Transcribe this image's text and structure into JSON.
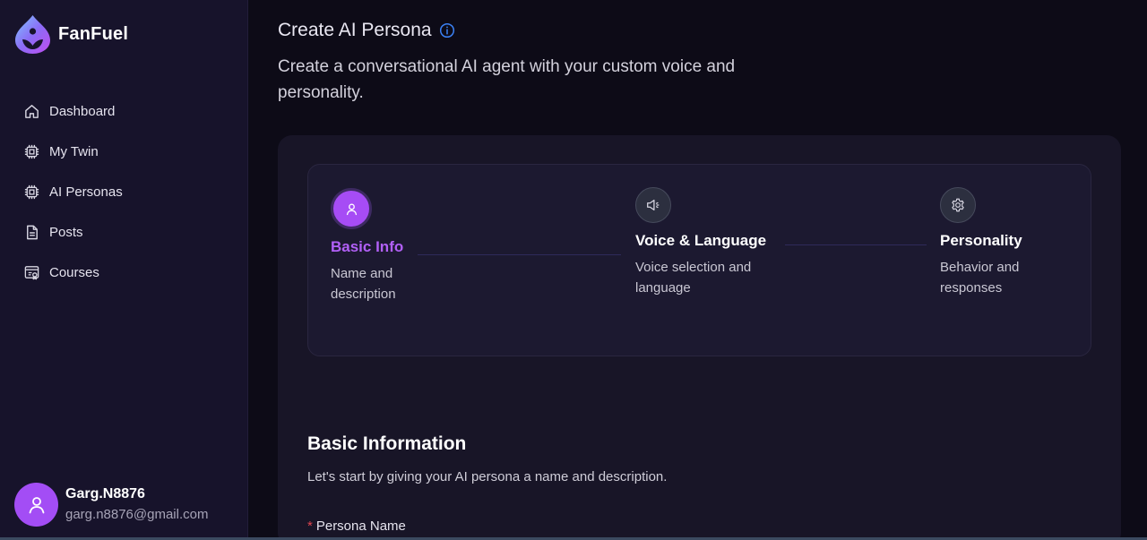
{
  "brand": {
    "name": "FanFuel"
  },
  "sidebar": {
    "items": [
      {
        "label": "Dashboard",
        "icon": "home-icon"
      },
      {
        "label": "My Twin",
        "icon": "chip-icon"
      },
      {
        "label": "AI Personas",
        "icon": "chip-icon"
      },
      {
        "label": "Posts",
        "icon": "document-icon"
      },
      {
        "label": "Courses",
        "icon": "courses-icon"
      }
    ]
  },
  "user": {
    "name": "Garg.N8876",
    "email": "garg.n8876@gmail.com"
  },
  "header": {
    "title": "Create AI Persona",
    "subtitle": "Create a conversational AI agent with your custom voice and personality."
  },
  "stepper": {
    "steps": [
      {
        "title": "Basic Info",
        "desc": "Name and description",
        "icon": "user-icon",
        "active": true
      },
      {
        "title": "Voice & Language",
        "desc": "Voice selection and language",
        "icon": "speaker-icon",
        "active": false
      },
      {
        "title": "Personality",
        "desc": "Behavior and responses",
        "icon": "gear-icon",
        "active": false
      }
    ]
  },
  "section": {
    "title": "Basic Information",
    "desc": "Let's start by giving your AI persona a name and description.",
    "field_label": "Persona Name",
    "required_mark": "*"
  },
  "colors": {
    "accent": "#a64cf5",
    "sidebar_bg": "#17132b",
    "page_bg": "#0d0b17",
    "card_bg": "#181527",
    "required": "#e0444f",
    "info": "#3b82f6"
  }
}
